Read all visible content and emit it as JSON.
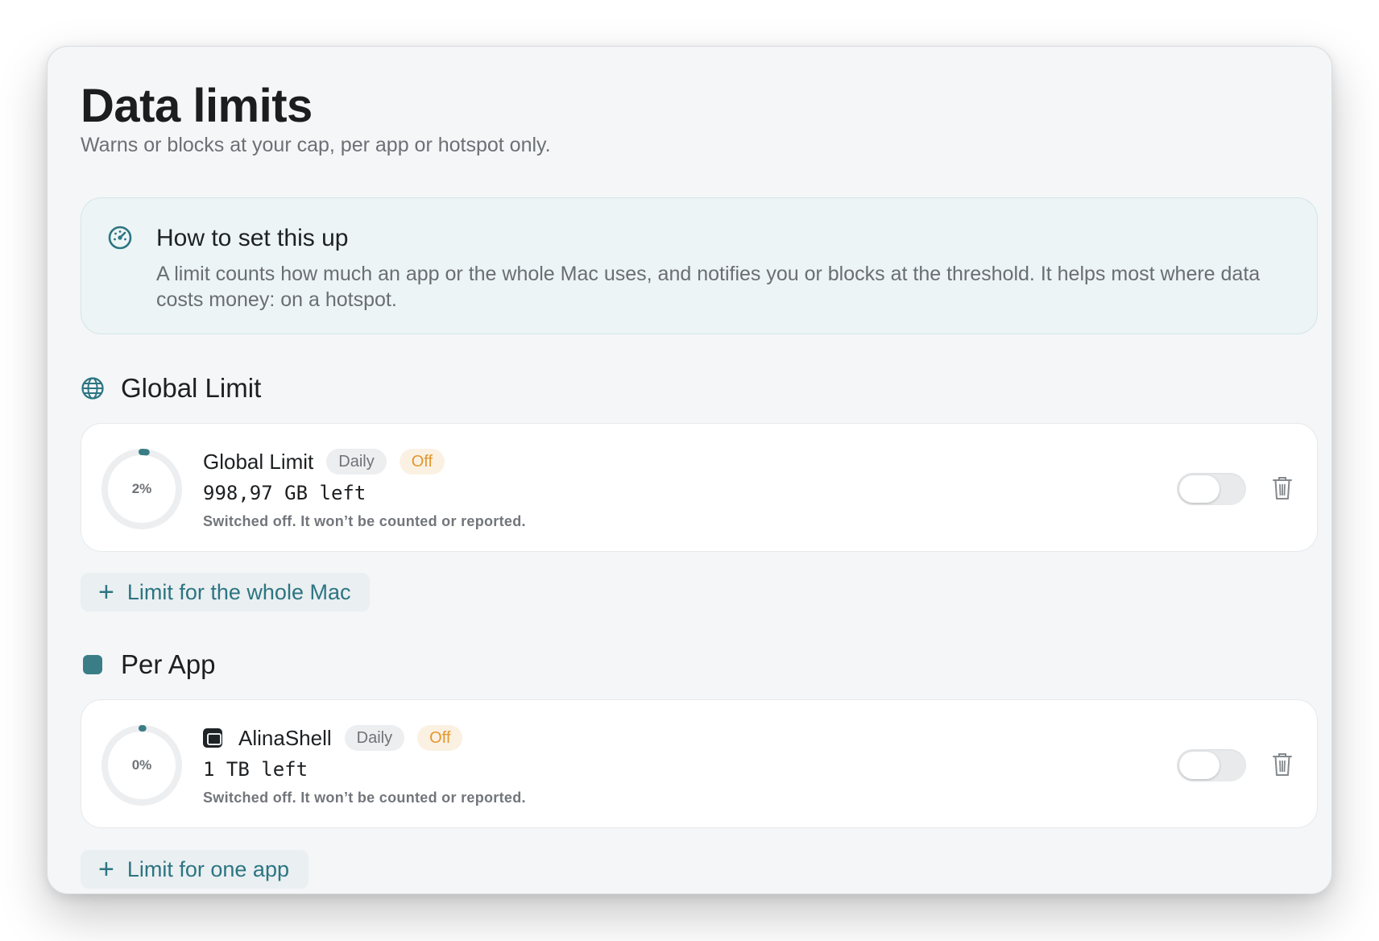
{
  "page": {
    "title": "Data limits",
    "subtitle": "Warns or blocks at your cap, per app or hotspot only."
  },
  "info": {
    "icon": "gauge-icon",
    "title": "How to set this up",
    "text": "A limit counts how much an app or the whole Mac uses, and notifies you or blocks at the threshold. It helps most where data costs money: on a hotspot."
  },
  "global_section": {
    "icon": "globe-icon",
    "title": "Global Limit",
    "card": {
      "name": "Global Limit",
      "period": "Daily",
      "status": "Off",
      "progress_percent": 2,
      "progress_label": "2%",
      "amount_left": "998,97 GB left",
      "note": "Switched off. It won’t be counted or reported.",
      "enabled": false
    },
    "add_label": "Limit for the whole Mac"
  },
  "app_section": {
    "icon": "square-icon",
    "title": "Per App",
    "card": {
      "app_icon": "terminal-app-icon",
      "name": "AlinaShell",
      "period": "Daily",
      "status": "Off",
      "progress_percent": 0,
      "progress_label": "0%",
      "amount_left": "1 TB left",
      "note": "Switched off. It won’t be counted or reported.",
      "enabled": false
    },
    "add_label": "Limit for one app"
  },
  "colors": {
    "accent": "#2c7581",
    "status_off": "#e3962e",
    "ring_track": "#eceef0",
    "ring_progress": "#3b7d86"
  }
}
